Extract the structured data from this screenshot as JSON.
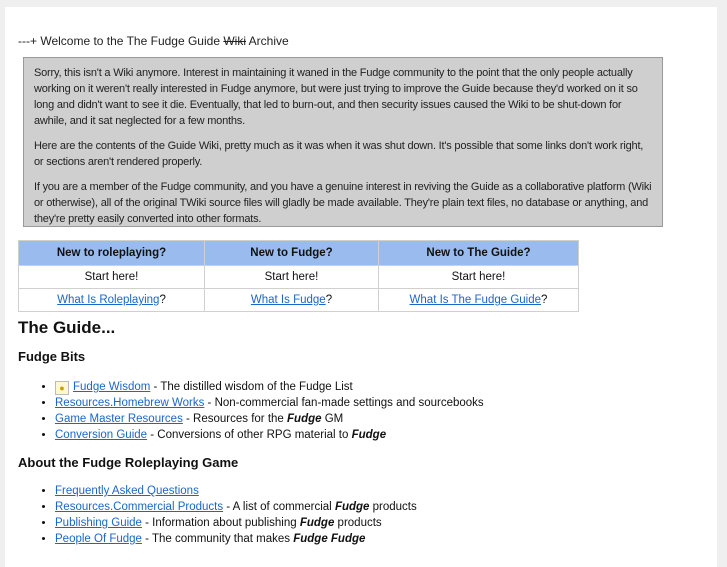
{
  "header": {
    "prefix": "---+ Welcome to the The Fudge Guide ",
    "struck": "Wiki",
    "suffix": " Archive"
  },
  "notice": {
    "paragraphs": [
      "Sorry, this isn't a Wiki anymore. Interest in maintaining it waned in the Fudge community to the point that the only people actually working on it weren't really interested in Fudge anymore, but were just trying to improve the Guide because they'd worked on it so long and didn't want to see it die. Eventually, that led to burn-out, and then security issues caused the Wiki to be shut-down for awhile, and it sat neglected for a few months.",
      "Here are the contents of the Guide Wiki, pretty much as it was when it was shut down. It's possible that some links don't work right, or sections aren't rendered properly.",
      "If you are a member of the Fudge community, and you have a genuine interest in reviving the Guide as a collaborative platform (Wiki or otherwise), all of the original TWiki source files will gladly be made available. They're plain text files, no database or anything, and they're pretty easily converted into other formats."
    ]
  },
  "start_table": {
    "headers": [
      "New to roleplaying?",
      "New to Fudge?",
      "New to The Guide?"
    ],
    "row1": [
      "Start here!",
      "Start here!",
      "Start here!"
    ],
    "links": [
      "What Is Roleplaying",
      "What Is Fudge",
      "What Is The Fudge Guide"
    ],
    "link_suffix": "?"
  },
  "guide": {
    "heading": "The Guide...",
    "fudge_bits": {
      "heading": "Fudge Bits",
      "items": [
        {
          "icon": "lightbulb-icon",
          "link": "Fudge Wisdom",
          "desc": " - The distilled wisdom of the Fudge List"
        },
        {
          "link": "Resources.Homebrew Works",
          "desc": " - Non-commercial fan-made settings and sourcebooks"
        },
        {
          "link": "Game Master Resources",
          "desc_pre": " - Resources for the ",
          "em": "Fudge",
          "desc_post": " GM"
        },
        {
          "link": "Conversion Guide",
          "desc_pre": " - Conversions of other RPG material to ",
          "em": "Fudge",
          "desc_post": ""
        }
      ]
    },
    "about": {
      "heading": "About the Fudge Roleplaying Game",
      "items": [
        {
          "link": "Frequently Asked Questions"
        },
        {
          "link": "Resources.Commercial Products",
          "desc_pre": " - A list of commercial ",
          "em": "Fudge",
          "desc_post": " products"
        },
        {
          "link": "Publishing Guide",
          "desc_pre": " - Information about publishing ",
          "em": "Fudge",
          "desc_post": " products"
        },
        {
          "link": "People Of Fudge",
          "desc_pre": " - The community that makes ",
          "em": "Fudge Fudge",
          "desc_post": ""
        }
      ]
    }
  }
}
